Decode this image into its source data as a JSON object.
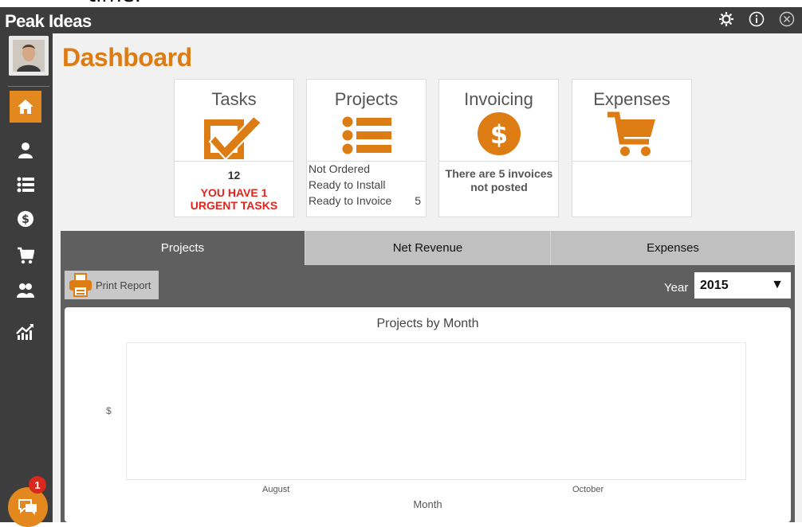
{
  "header": {
    "app_title": "Peak Ideas",
    "top_fragment": "time."
  },
  "header_icons": [
    "gear-icon",
    "info-icon",
    "close-circle-icon"
  ],
  "sidebar": {
    "items": [
      {
        "name": "home",
        "icon": "home-icon",
        "active": true
      },
      {
        "name": "user",
        "icon": "user-icon",
        "active": false
      },
      {
        "name": "list",
        "icon": "list-icon",
        "active": false
      },
      {
        "name": "money",
        "icon": "dollar-icon",
        "active": false
      },
      {
        "name": "cart",
        "icon": "cart-icon",
        "active": false
      },
      {
        "name": "team",
        "icon": "team-icon",
        "active": false
      },
      {
        "name": "reports",
        "icon": "chart-icon",
        "active": false
      }
    ],
    "chat_badge": "1"
  },
  "page": {
    "title": "Dashboard"
  },
  "cards": {
    "tasks": {
      "title": "Tasks",
      "count": "12",
      "urgent": "YOU HAVE 1 URGENT TASKS"
    },
    "projects": {
      "title": "Projects",
      "rows": [
        {
          "label": "Not Ordered",
          "value": ""
        },
        {
          "label": "Ready to Install",
          "value": ""
        },
        {
          "label": "Ready to Invoice",
          "value": "5"
        }
      ]
    },
    "invoicing": {
      "title": "Invoicing",
      "message": "There are 5 invoices not posted"
    },
    "expenses": {
      "title": "Expenses"
    }
  },
  "tabs": [
    {
      "label": "Projects",
      "active": true
    },
    {
      "label": "Net Revenue",
      "active": false
    },
    {
      "label": "Expenses",
      "active": false
    }
  ],
  "toolbar": {
    "print_label": "Print Report",
    "year_label": "Year",
    "year_value": "2015"
  },
  "chart_data": {
    "type": "line",
    "title": "Projects by Month",
    "xlabel": "Month",
    "ylabel": "$",
    "x_ticks": [
      "August",
      "October"
    ],
    "series": []
  },
  "colors": {
    "accent": "#e2881e",
    "title_orange": "#dd7c13",
    "dark": "#3d3d3d",
    "panel": "#5f5f5f",
    "urgent_red": "#e3241b"
  }
}
